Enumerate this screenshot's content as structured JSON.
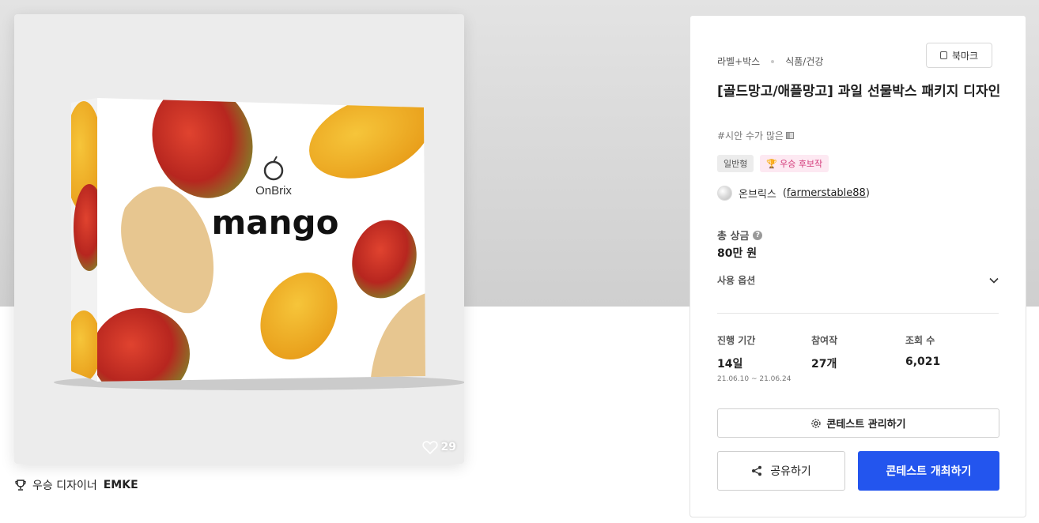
{
  "image": {
    "alt": "mango gift box",
    "likes": "29",
    "winner_label": "우승 디자이너",
    "winner_name": "EMKE",
    "box_brand": "OnBrix",
    "box_word": "mango"
  },
  "panel": {
    "category_1": "라벨+박스",
    "category_2": "식품/건강",
    "bookmark_label": "북마크",
    "title": "[골드망고/애플망고] 과일 선물박스 패키지 디자인",
    "tag_line": "#시안 수가 많은",
    "badge_type": "일반형",
    "badge_winner": "우승 후보작",
    "owner_name": "온브릭스",
    "owner_handle": "farmerstable88",
    "prize_label": "총 상금",
    "prize_value": "80만 원",
    "options_label": "사용 옵션",
    "stats": {
      "period_label": "진행 기간",
      "period_value": "14일",
      "period_dates": "21.06.10 ~ 21.06.24",
      "entries_label": "참여작",
      "entries_value": "27개",
      "views_label": "조회 수",
      "views_value": "6,021"
    },
    "manage_button": "콘테스트 관리하기",
    "share_button": "공유하기",
    "host_button": "콘테스트 개최하기"
  },
  "colors": {
    "primary": "#2355ee",
    "badge_pink": "#d43a7a",
    "mango_red": "#c8322a",
    "mango_yellow": "#f0b42a",
    "kraft": "#e7c690"
  }
}
